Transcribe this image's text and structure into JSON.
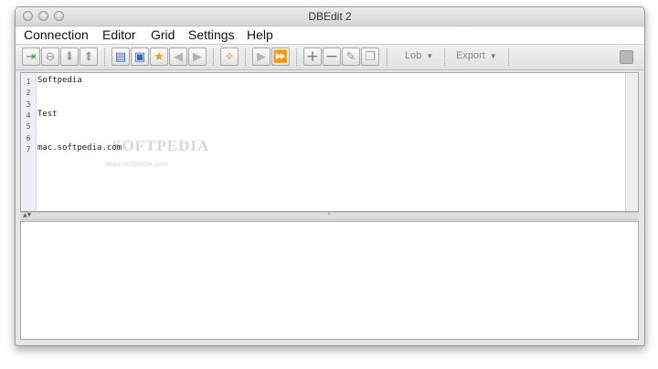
{
  "window": {
    "title": "DBEdit 2"
  },
  "menu": [
    "Connection",
    "Editor",
    "Grid",
    "Settings",
    "Help"
  ],
  "toolbar": {
    "buttons": [
      {
        "name": "connect-icon",
        "glyph": "⇥",
        "color": "#3a9a3a"
      },
      {
        "name": "disconnect-icon",
        "glyph": "⊖",
        "color": "#9c9c9c"
      },
      {
        "name": "download-icon",
        "glyph": "⬇",
        "color": "#9c9c9c"
      },
      {
        "name": "upload-icon",
        "glyph": "⬆",
        "color": "#9c9c9c"
      },
      {
        "name": "open-file-icon",
        "glyph": "▤",
        "color": "#3b63b5"
      },
      {
        "name": "save-file-icon",
        "glyph": "▣",
        "color": "#3b63b5"
      },
      {
        "name": "favorite-star-icon",
        "glyph": "★",
        "color": "#e8a317"
      },
      {
        "name": "back-arrow-icon",
        "glyph": "◀",
        "color": "#b5b5b5"
      },
      {
        "name": "forward-arrow-icon",
        "glyph": "▶",
        "color": "#b5b5b5"
      },
      {
        "name": "magic-wand-icon",
        "glyph": "✧",
        "color": "#d08a17"
      },
      {
        "name": "run-icon",
        "glyph": "▶",
        "color": "#b5b5b5"
      },
      {
        "name": "run-all-icon",
        "glyph": "⏩",
        "color": "#b5b5b5"
      },
      {
        "name": "add-row-icon",
        "glyph": "+",
        "color": "#7a7a7a"
      },
      {
        "name": "remove-row-icon",
        "glyph": "−",
        "color": "#7a7a7a"
      },
      {
        "name": "edit-row-icon",
        "glyph": "✎",
        "color": "#9a9a9a"
      },
      {
        "name": "copy-row-icon",
        "glyph": "❐",
        "color": "#9a9a9a"
      }
    ],
    "lob_label": "Lob",
    "export_label": "Export",
    "right_button_icon": "stop-icon"
  },
  "editor": {
    "line_numbers": [
      "1",
      "2",
      "3",
      "4",
      "5",
      "6",
      "7"
    ],
    "lines": [
      "Softpedia",
      "",
      "",
      "Test",
      "",
      "",
      "mac.softpedia.com"
    ],
    "watermark": "SOFTPEDIA",
    "watermark_sub": "www.softpedia.com"
  }
}
